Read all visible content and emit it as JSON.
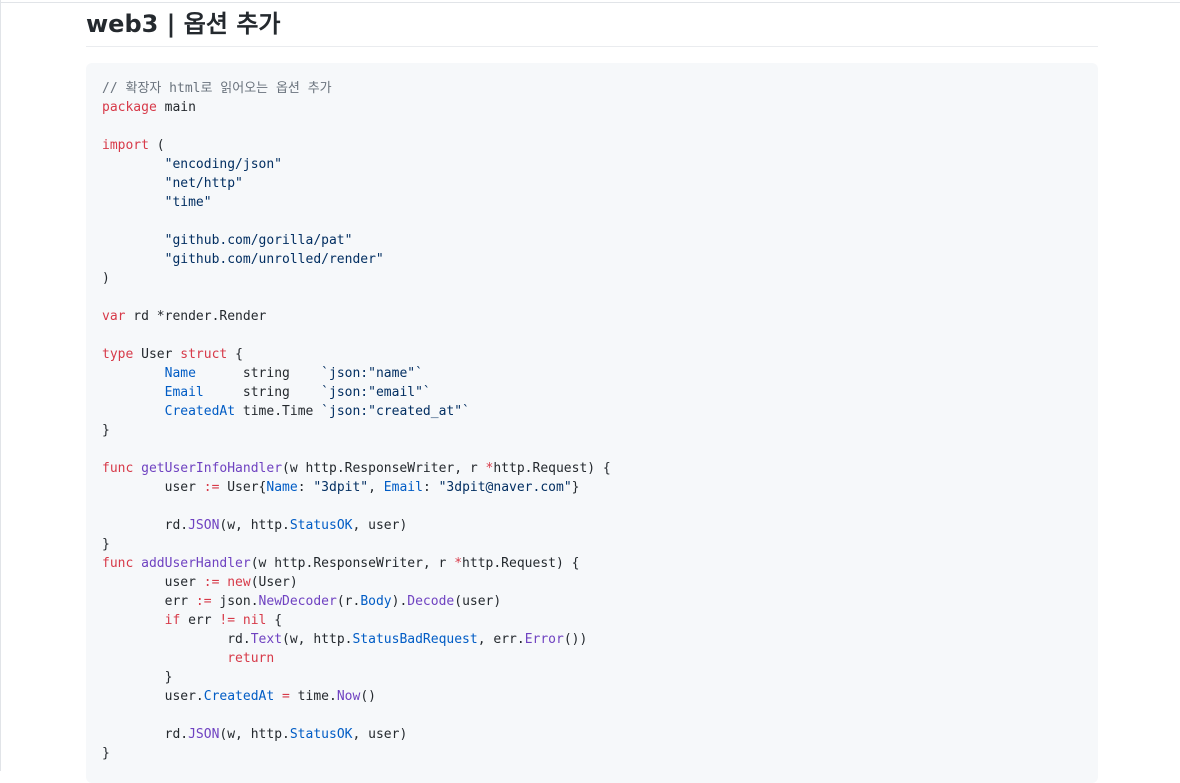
{
  "page": {
    "title": "web3 | 옵션 추가"
  },
  "colors": {
    "comment": "#6a737d",
    "keyword": "#d73a49",
    "string": "#032f62",
    "field": "#005cc5",
    "function": "#6f42c1",
    "plain": "#24292e",
    "code_background": "#f6f8fa"
  },
  "code": {
    "language": "go",
    "lines": [
      [
        {
          "t": "// 확장자 html로 읽어오는 옵션 추가",
          "c": "comment"
        }
      ],
      [
        {
          "t": "package",
          "c": "keyword"
        },
        {
          "t": " main",
          "c": "plain"
        }
      ],
      [],
      [
        {
          "t": "import",
          "c": "keyword"
        },
        {
          "t": " (",
          "c": "plain"
        }
      ],
      [
        {
          "t": "        \"encoding/json\"",
          "c": "string"
        }
      ],
      [
        {
          "t": "        \"net/http\"",
          "c": "string"
        }
      ],
      [
        {
          "t": "        \"time\"",
          "c": "string"
        }
      ],
      [],
      [
        {
          "t": "        \"github.com/gorilla/pat\"",
          "c": "string"
        }
      ],
      [
        {
          "t": "        \"github.com/unrolled/render\"",
          "c": "string"
        }
      ],
      [
        {
          "t": ")",
          "c": "plain"
        }
      ],
      [],
      [
        {
          "t": "var",
          "c": "keyword"
        },
        {
          "t": " rd *render.Render",
          "c": "plain"
        }
      ],
      [],
      [
        {
          "t": "type",
          "c": "keyword"
        },
        {
          "t": " User ",
          "c": "plain"
        },
        {
          "t": "struct",
          "c": "keyword"
        },
        {
          "t": " {",
          "c": "plain"
        }
      ],
      [
        {
          "t": "        ",
          "c": "plain"
        },
        {
          "t": "Name",
          "c": "field"
        },
        {
          "t": "      string    ",
          "c": "plain"
        },
        {
          "t": "`json:\"name\"`",
          "c": "string"
        }
      ],
      [
        {
          "t": "        ",
          "c": "plain"
        },
        {
          "t": "Email",
          "c": "field"
        },
        {
          "t": "     string    ",
          "c": "plain"
        },
        {
          "t": "`json:\"email\"`",
          "c": "string"
        }
      ],
      [
        {
          "t": "        ",
          "c": "plain"
        },
        {
          "t": "CreatedAt",
          "c": "field"
        },
        {
          "t": " time.Time ",
          "c": "plain"
        },
        {
          "t": "`json:\"created_at\"`",
          "c": "string"
        }
      ],
      [
        {
          "t": "}",
          "c": "plain"
        }
      ],
      [],
      [
        {
          "t": "func",
          "c": "keyword"
        },
        {
          "t": " ",
          "c": "plain"
        },
        {
          "t": "getUserInfoHandler",
          "c": "func"
        },
        {
          "t": "(w http.ResponseWriter, r ",
          "c": "plain"
        },
        {
          "t": "*",
          "c": "keyword"
        },
        {
          "t": "http.Request) {",
          "c": "plain"
        }
      ],
      [
        {
          "t": "        user ",
          "c": "plain"
        },
        {
          "t": ":=",
          "c": "keyword"
        },
        {
          "t": " User{",
          "c": "plain"
        },
        {
          "t": "Name",
          "c": "field"
        },
        {
          "t": ": ",
          "c": "plain"
        },
        {
          "t": "\"3dpit\"",
          "c": "string"
        },
        {
          "t": ", ",
          "c": "plain"
        },
        {
          "t": "Email",
          "c": "field"
        },
        {
          "t": ": ",
          "c": "plain"
        },
        {
          "t": "\"3dpit@naver.com\"",
          "c": "string"
        },
        {
          "t": "}",
          "c": "plain"
        }
      ],
      [],
      [
        {
          "t": "        rd.",
          "c": "plain"
        },
        {
          "t": "JSON",
          "c": "func"
        },
        {
          "t": "(w, http.",
          "c": "plain"
        },
        {
          "t": "StatusOK",
          "c": "field"
        },
        {
          "t": ", user)",
          "c": "plain"
        }
      ],
      [
        {
          "t": "}",
          "c": "plain"
        }
      ],
      [
        {
          "t": "func",
          "c": "keyword"
        },
        {
          "t": " ",
          "c": "plain"
        },
        {
          "t": "addUserHandler",
          "c": "func"
        },
        {
          "t": "(w http.ResponseWriter, r ",
          "c": "plain"
        },
        {
          "t": "*",
          "c": "keyword"
        },
        {
          "t": "http.Request) {",
          "c": "plain"
        }
      ],
      [
        {
          "t": "        user ",
          "c": "plain"
        },
        {
          "t": ":=",
          "c": "keyword"
        },
        {
          "t": " ",
          "c": "plain"
        },
        {
          "t": "new",
          "c": "keyword"
        },
        {
          "t": "(User)",
          "c": "plain"
        }
      ],
      [
        {
          "t": "        err ",
          "c": "plain"
        },
        {
          "t": ":=",
          "c": "keyword"
        },
        {
          "t": " json.",
          "c": "plain"
        },
        {
          "t": "NewDecoder",
          "c": "func"
        },
        {
          "t": "(r.",
          "c": "plain"
        },
        {
          "t": "Body",
          "c": "field"
        },
        {
          "t": ").",
          "c": "plain"
        },
        {
          "t": "Decode",
          "c": "func"
        },
        {
          "t": "(user)",
          "c": "plain"
        }
      ],
      [
        {
          "t": "        ",
          "c": "plain"
        },
        {
          "t": "if",
          "c": "keyword"
        },
        {
          "t": " err ",
          "c": "plain"
        },
        {
          "t": "!=",
          "c": "keyword"
        },
        {
          "t": " ",
          "c": "plain"
        },
        {
          "t": "nil",
          "c": "keyword"
        },
        {
          "t": " {",
          "c": "plain"
        }
      ],
      [
        {
          "t": "                rd.",
          "c": "plain"
        },
        {
          "t": "Text",
          "c": "func"
        },
        {
          "t": "(w, http.",
          "c": "plain"
        },
        {
          "t": "StatusBadRequest",
          "c": "field"
        },
        {
          "t": ", err.",
          "c": "plain"
        },
        {
          "t": "Error",
          "c": "func"
        },
        {
          "t": "())",
          "c": "plain"
        }
      ],
      [
        {
          "t": "                ",
          "c": "plain"
        },
        {
          "t": "return",
          "c": "keyword"
        }
      ],
      [
        {
          "t": "        }",
          "c": "plain"
        }
      ],
      [
        {
          "t": "        user.",
          "c": "plain"
        },
        {
          "t": "CreatedAt",
          "c": "field"
        },
        {
          "t": " ",
          "c": "plain"
        },
        {
          "t": "=",
          "c": "keyword"
        },
        {
          "t": " time.",
          "c": "plain"
        },
        {
          "t": "Now",
          "c": "func"
        },
        {
          "t": "()",
          "c": "plain"
        }
      ],
      [],
      [
        {
          "t": "        rd.",
          "c": "plain"
        },
        {
          "t": "JSON",
          "c": "func"
        },
        {
          "t": "(w, http.",
          "c": "plain"
        },
        {
          "t": "StatusOK",
          "c": "field"
        },
        {
          "t": ", user)",
          "c": "plain"
        }
      ],
      [
        {
          "t": "}",
          "c": "plain"
        }
      ]
    ]
  }
}
